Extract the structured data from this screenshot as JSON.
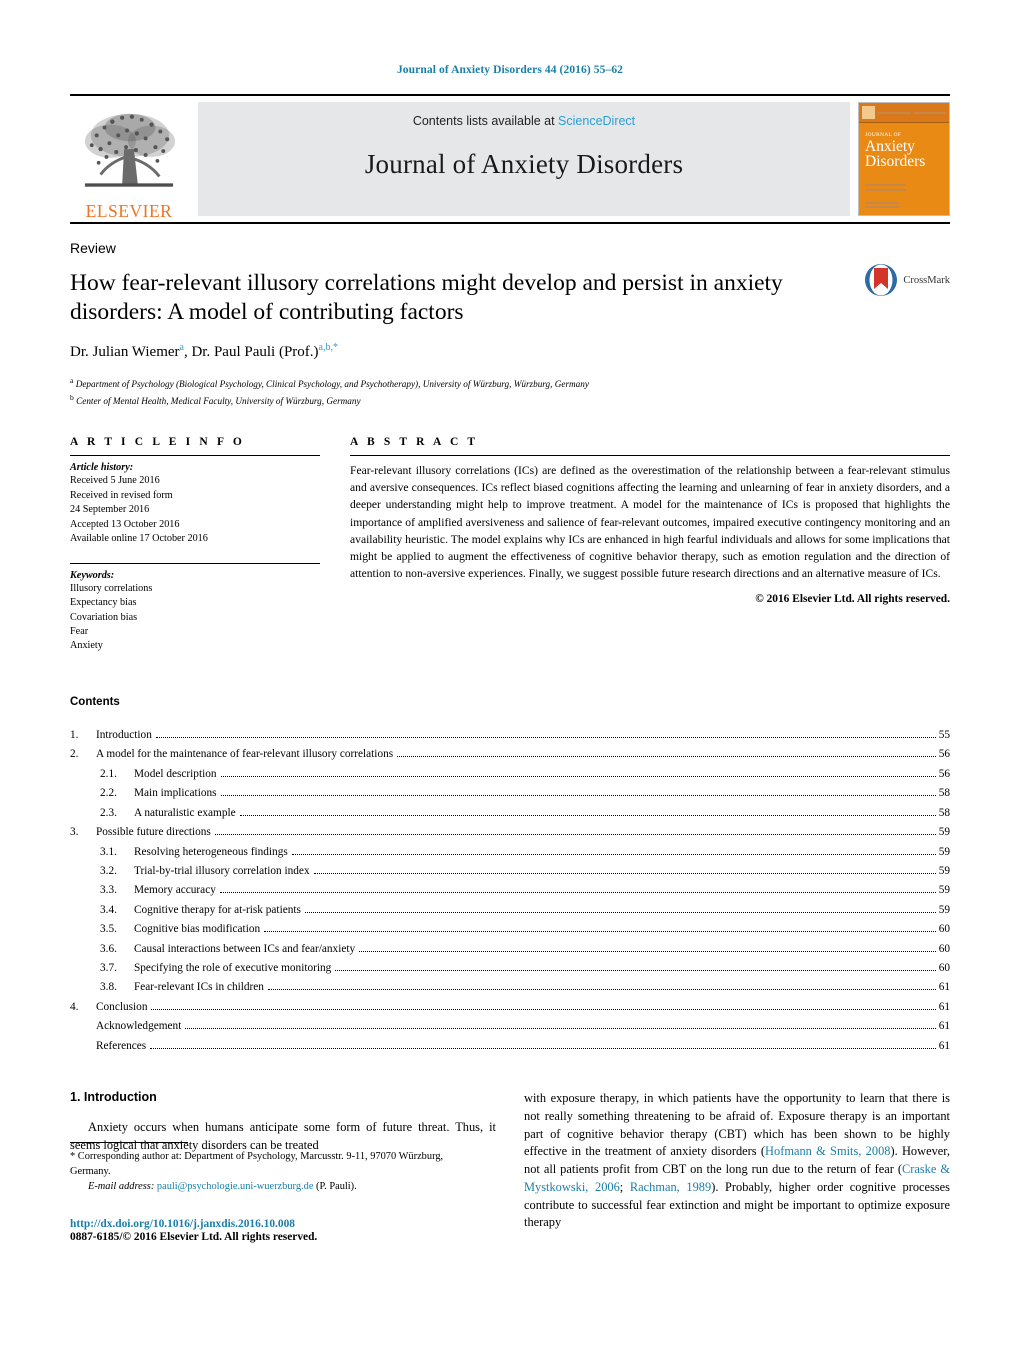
{
  "running_header": "Journal of Anxiety Disorders 44 (2016) 55–62",
  "masthead": {
    "elsevier_wordmark": "ELSEVIER",
    "contents_lists_prefix": "Contents lists available at ",
    "sciencedirect_link": "ScienceDirect",
    "journal_name": "Journal of Anxiety Disorders",
    "cover": {
      "line1": "JOURNAL OF",
      "line2": "Anxiety",
      "line3": "Disorders"
    },
    "link_color": "#2a9fd6"
  },
  "title_block": {
    "article_type": "Review",
    "title": "How fear-relevant illusory correlations might develop and persist in anxiety disorders: A model of contributing factors",
    "authors_prefix": "Dr. Julian Wiemer",
    "author1_sup": "a",
    "authors_mid": ", Dr. Paul Pauli (Prof.)",
    "author2_sup": "a,b,",
    "author2_star": "*",
    "affiliation_a_sup": "a",
    "affiliation_a": " Department of Psychology (Biological Psychology, Clinical Psychology, and Psychotherapy), University of Würzburg, Würzburg, Germany",
    "affiliation_b_sup": "b",
    "affiliation_b": " Center of Mental Health, Medical Faculty, University of Würzburg, Germany",
    "crossmark_label": "CrossMark"
  },
  "article_info": {
    "heading": "A R T I C L E   I N F O",
    "history_label": "Article history:",
    "history": [
      "Received 5 June 2016",
      "Received in revised form",
      "24 September 2016",
      "Accepted 13 October 2016",
      "Available online 17 October 2016"
    ],
    "keywords_label": "Keywords:",
    "keywords": [
      "Illusory correlations",
      "Expectancy bias",
      "Covariation bias",
      "Fear",
      "Anxiety"
    ]
  },
  "abstract": {
    "heading": "A B S T R A C T",
    "body": "Fear-relevant illusory correlations (ICs) are defined as the overestimation of the relationship between a fear-relevant stimulus and aversive consequences. ICs reflect biased cognitions affecting the learning and unlearning of fear in anxiety disorders, and a deeper understanding might help to improve treatment. A model for the maintenance of ICs is proposed that highlights the importance of amplified aversiveness and salience of fear-relevant outcomes, impaired executive contingency monitoring and an availability heuristic. The model explains why ICs are enhanced in high fearful individuals and allows for some implications that might be applied to augment the effectiveness of cognitive behavior therapy, such as emotion regulation and the direction of attention to non-aversive experiences. Finally, we suggest possible future research directions and an alternative measure of ICs.",
    "copyright": "© 2016 Elsevier Ltd. All rights reserved."
  },
  "contents": {
    "title": "Contents",
    "entries": [
      {
        "num": "1.",
        "level": 1,
        "label": "Introduction",
        "page": "55"
      },
      {
        "num": "2.",
        "level": 1,
        "label": "A model for the maintenance of fear-relevant illusory correlations",
        "page": "56"
      },
      {
        "num": "2.1.",
        "level": 2,
        "label": "Model description",
        "page": "56"
      },
      {
        "num": "2.2.",
        "level": 2,
        "label": "Main implications",
        "page": "58"
      },
      {
        "num": "2.3.",
        "level": 2,
        "label": "A naturalistic example",
        "page": "58"
      },
      {
        "num": "3.",
        "level": 1,
        "label": "Possible future directions",
        "page": "59"
      },
      {
        "num": "3.1.",
        "level": 2,
        "label": "Resolving heterogeneous findings",
        "page": "59"
      },
      {
        "num": "3.2.",
        "level": 2,
        "label": "Trial-by-trial illusory correlation index",
        "page": "59"
      },
      {
        "num": "3.3.",
        "level": 2,
        "label": "Memory accuracy",
        "page": "59"
      },
      {
        "num": "3.4.",
        "level": 2,
        "label": "Cognitive therapy for at-risk patients",
        "page": "59"
      },
      {
        "num": "3.5.",
        "level": 2,
        "label": "Cognitive bias modification",
        "page": "60"
      },
      {
        "num": "3.6.",
        "level": 2,
        "label": "Causal interactions between ICs and fear/anxiety",
        "page": "60"
      },
      {
        "num": "3.7.",
        "level": 2,
        "label": "Specifying the role of executive monitoring",
        "page": "60"
      },
      {
        "num": "3.8.",
        "level": 2,
        "label": "Fear-relevant ICs in children",
        "page": "61"
      },
      {
        "num": "4.",
        "level": 1,
        "label": "Conclusion",
        "page": "61"
      },
      {
        "num": "",
        "level": 1,
        "label": "Acknowledgement",
        "page": "61"
      },
      {
        "num": "",
        "level": 1,
        "label": "References",
        "page": "61"
      }
    ]
  },
  "introduction": {
    "heading": "1.  Introduction",
    "left_paragraph": "Anxiety occurs when humans anticipate some form of future threat. Thus, it seems logical that anxiety disorders can be treated",
    "right_part1": "with exposure therapy, in which patients have the opportunity to learn that there is not really something threatening to be afraid of. Exposure therapy is an important part of cognitive behavior therapy (CBT) which has been shown to be highly effective in the treatment of anxiety disorders (",
    "right_cit1": "Hofmann & Smits, 2008",
    "right_part2": "). However, not all patients profit from CBT on the long run due to the return of fear (",
    "right_cit2": "Craske & Mystkowski, 2006",
    "right_part3": "; ",
    "right_cit3": "Rachman, 1989",
    "right_part4": "). Probably, higher order cognitive processes contribute to successful fear extinction and might be important to optimize exposure therapy"
  },
  "footnotes": {
    "corresponding_star": "*",
    "corresponding_text": " Corresponding author at: Department of Psychology, Marcusstr. 9-11, 97070 Würzburg, Germany.",
    "email_label": "E-mail address:",
    "email": "pauli@psychologie.uni-wuerzburg.de",
    "email_suffix": " (P. Pauli).",
    "doi": "http://dx.doi.org/10.1016/j.janxdis.2016.10.008",
    "issn": "0887-6185/© 2016 Elsevier Ltd. All rights reserved."
  }
}
